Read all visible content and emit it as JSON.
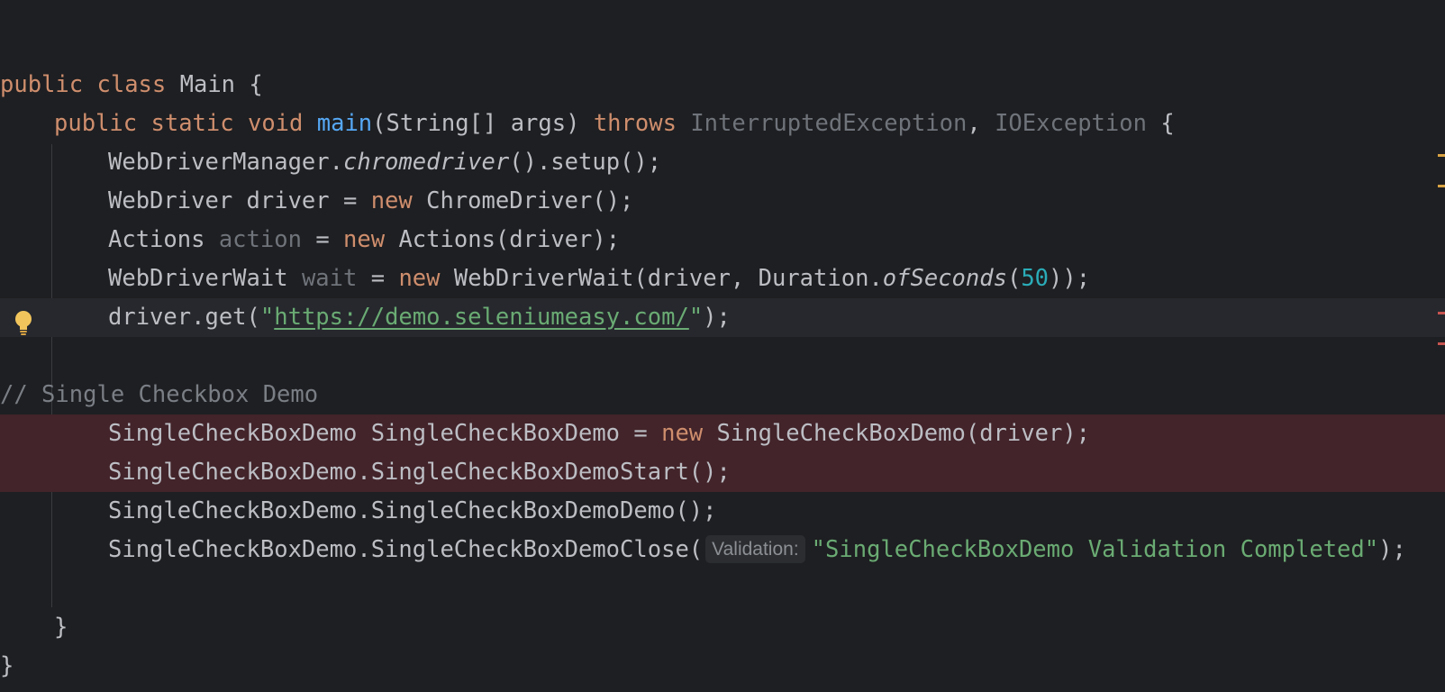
{
  "editor": {
    "colors": {
      "background": "#1e1f22",
      "current_line": "#26282e",
      "error_line": "#42242a",
      "keyword": "#cf8e6d",
      "function": "#56a8f5",
      "string": "#6aab73",
      "number": "#2aacb8",
      "comment": "#7a7e85",
      "warning_marker": "#d9a343",
      "error_marker": "#c75450"
    },
    "gutter_icon": "lightbulb-icon",
    "scrollbar_markers": [
      "warning",
      "warning",
      "error",
      "error"
    ],
    "lines": {
      "l1": {
        "kw1": "public",
        "kw2": "class",
        "name": "Main",
        "brace": "{"
      },
      "l2": {
        "kw1": "public",
        "kw2": "static",
        "kw3": "void",
        "method": "main",
        "params": "(String[] args)",
        "throws": "throws",
        "ex1": "InterruptedException",
        "comma": ",",
        "ex2": "IOException",
        "brace": "{"
      },
      "l3": {
        "obj": "WebDriverManager.",
        "call": "chromedriver",
        "rest": "().setup();"
      },
      "l4": {
        "decl": "WebDriver driver = ",
        "new": "new",
        "rest": "ChromeDriver();"
      },
      "l5": {
        "type": "Actions",
        "var": "action",
        "eq": "= ",
        "new": "new",
        "rest": "Actions(driver);"
      },
      "l6": {
        "type": "WebDriverWait",
        "var": "wait",
        "eq": "= ",
        "new": "new",
        "mid": "WebDriverWait(driver, Duration.",
        "call": "ofSeconds",
        "open": "(",
        "num": "50",
        "close": "));"
      },
      "l7": {
        "pre": "driver.get(",
        "q1": "\"",
        "url": "https://demo.seleniumeasy.com/",
        "q2": "\"",
        "post": ");"
      },
      "l8": {
        "comment": "// Single Checkbox Demo"
      },
      "l9": {
        "decl": "SingleCheckBoxDemo SingleCheckBoxDemo = ",
        "new": "new",
        "rest": "SingleCheckBoxDemo(driver);"
      },
      "l10": {
        "text": "SingleCheckBoxDemo.SingleCheckBoxDemoStart();"
      },
      "l11": {
        "text": "SingleCheckBoxDemo.SingleCheckBoxDemoDemo();"
      },
      "l12": {
        "pre": "SingleCheckBoxDemo.SingleCheckBoxDemoClose(",
        "hint": "Validation:",
        "str": "\"SingleCheckBoxDemo Validation Completed\"",
        "post": ");"
      },
      "l13": {
        "brace": "}"
      },
      "l14": {
        "brace": "}"
      }
    }
  }
}
